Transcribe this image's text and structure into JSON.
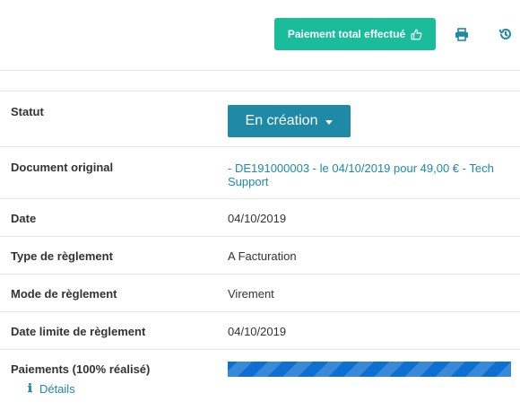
{
  "toolbar": {
    "paid_button_label": "Paiement total effectué",
    "paid_button_icon": "thumbs-up-icon",
    "print_icon": "print-icon",
    "history_icon": "history-icon"
  },
  "fields": {
    "status": {
      "label": "Statut",
      "value": "En création"
    },
    "original_document": {
      "label": "Document original",
      "value": "- DE191000003 - le 04/10/2019 pour 49,00 € - Tech Support"
    },
    "date": {
      "label": "Date",
      "value": "04/10/2019"
    },
    "payment_type": {
      "label": "Type de règlement",
      "value": "A Facturation"
    },
    "payment_mode": {
      "label": "Mode de règlement",
      "value": "Virement"
    },
    "payment_deadline": {
      "label": "Date limite de règlement",
      "value": "04/10/2019"
    },
    "payments": {
      "label": "Paiements (100% réalisé)",
      "progress_percent": 100,
      "details_label": "Détails"
    }
  },
  "colors": {
    "paid_button": "#1abc9c",
    "primary": "#1e8aa6",
    "progress": "#0d6fcf"
  }
}
